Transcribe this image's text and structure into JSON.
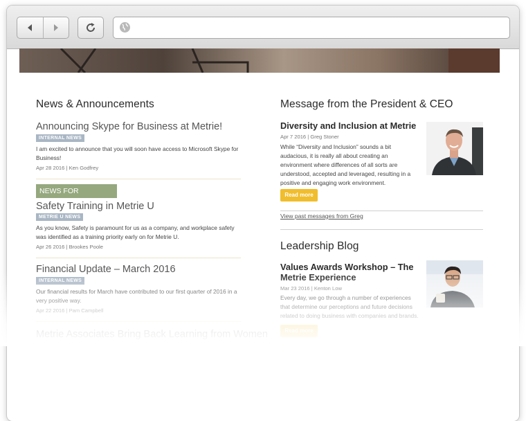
{
  "browser": {
    "back_icon": "back-arrow-icon",
    "forward_icon": "forward-arrow-icon",
    "reload_icon": "reload-icon",
    "globe_icon": "globe-icon"
  },
  "news": {
    "heading": "News & Announcements",
    "items": [
      {
        "title": "Announcing Skype for Business at Metrie!",
        "tag": "INTERNAL NEWS",
        "body1": "I am excited to announce that you will soon have access to Microsoft Skype for",
        "body2": "Business!",
        "meta": "Apr 28 2016 | Ken Godfrey"
      },
      {
        "banner": "NEWS FOR MANAGERS",
        "title": "Safety Training in Metrie U",
        "tag": "METRIE U NEWS",
        "body1": "As you know, Safety is paramount for us as a company, and workplace safety",
        "body2": "was identified as a training priority early on for Metrie U.",
        "meta": "Apr 26 2016 | Brookes Poole"
      },
      {
        "title": "Financial Update – March 2016",
        "tag": "INTERNAL NEWS",
        "body1": "Our financial results for March have contributed to our first quarter of 2016 in a",
        "body2": "very positive way.",
        "meta": "Apr 22 2016 | Pam Campbell"
      },
      {
        "title": "Metrie Associates Bring Back Learning from Women"
      }
    ]
  },
  "president": {
    "heading": "Message from the President & CEO",
    "title": "Diversity and Inclusion at Metrie",
    "meta": "Apr 7 2016 | Greg Stoner",
    "lines": [
      "While “Diversity and Inclusion” sounds a bit",
      "audacious, it is really all about creating an",
      "environment where differences of all sorts are",
      "understood, accepted and leveraged, resulting in a",
      "positive and engaging work environment."
    ],
    "button": "Read more",
    "past_link": "View past messages from Greg"
  },
  "blog": {
    "heading": "Leadership Blog",
    "title1": "Values Awards Workshop – The",
    "title2": "Metrie Experience",
    "meta": "Mar 23 2016 | Kenton Low",
    "lines": [
      "Every day, we go through a number of experiences",
      "that determine our perceptions and future decisions",
      "related to doing business with companies and brands."
    ],
    "button": "Read more"
  },
  "colors": {
    "tag_bg": "#a9b6c4",
    "manager_banner": "#95a87e",
    "read_more": "#f0bd2d"
  }
}
